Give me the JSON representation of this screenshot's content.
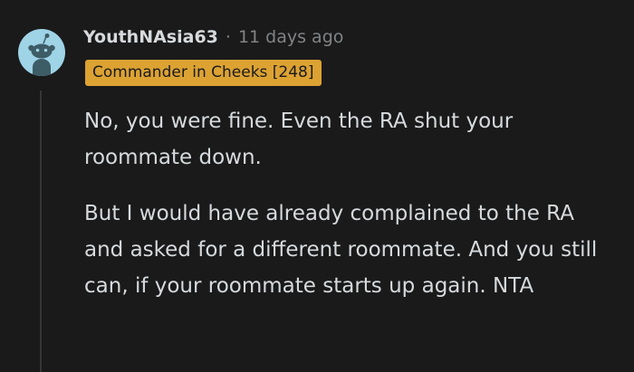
{
  "comment": {
    "username": "YouthNAsia63",
    "separator": "·",
    "timestamp": "11 days ago",
    "flair": "Commander in Cheeks [248]",
    "paragraphs": [
      "No, you were fine. Even the RA shut your roommate down.",
      "But I would have already complained to the RA and asked for a different roommate. And you still can, if your roommate starts up again. NTA"
    ]
  },
  "colors": {
    "background": "#1a1a1b",
    "text": "#d7dadc",
    "muted": "#818384",
    "flair_background": "#dca232",
    "avatar_background": "#9fd3e6"
  },
  "icons": {
    "avatar": "snoo-avatar-icon"
  }
}
